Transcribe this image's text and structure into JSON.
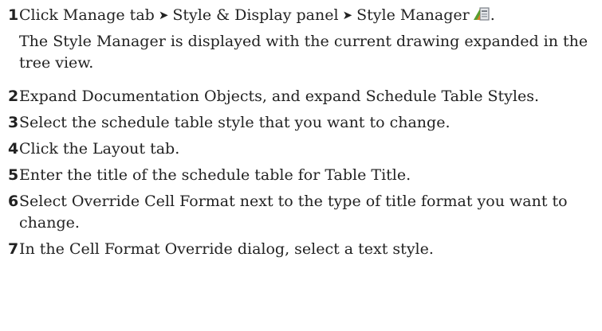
{
  "steps": [
    {
      "number": "1",
      "parts": [
        "Click Manage tab",
        "Style & Display panel",
        "Style Manager"
      ],
      "separator": "➤",
      "trailing": "."
    },
    {
      "number": "2",
      "text": "Expand Documentation Objects, and expand Schedule Table Styles."
    },
    {
      "number": "3",
      "text": "Select the schedule table style that you want to change."
    },
    {
      "number": "4",
      "text": "Click the Layout tab."
    },
    {
      "number": "5",
      "text": "Enter the title of the schedule table for Table Title."
    },
    {
      "number": "6",
      "text": "Select Override Cell Format next to the type of title format you want to change."
    },
    {
      "number": "7",
      "text": "In the Cell Format Override dialog, select a text style."
    }
  ],
  "note_1": "The Style Manager is displayed with the current drawing expanded in the tree view.",
  "icons": {
    "style_manager": "style-manager-icon"
  },
  "colors": {
    "text": "#222222",
    "icon_green": "#5a9e2f",
    "icon_orange": "#d9822b",
    "icon_gray": "#7a7f87"
  }
}
